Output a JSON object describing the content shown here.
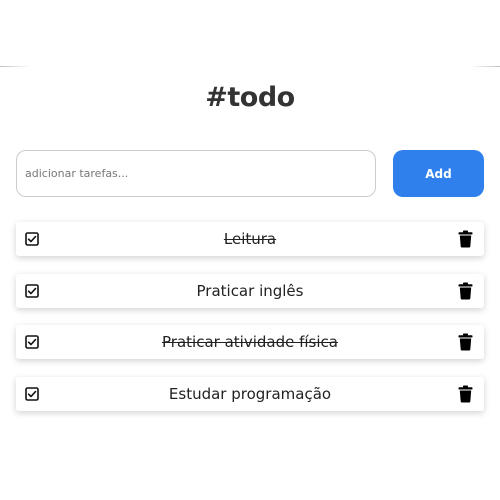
{
  "header": {
    "title": "#todo"
  },
  "form": {
    "input_placeholder": "adicionar tarefas...",
    "input_value": "",
    "add_label": "Add"
  },
  "tasks": [
    {
      "label": "Leitura",
      "done": true
    },
    {
      "label": "Praticar inglês",
      "done": false
    },
    {
      "label": "Praticar atividade física",
      "done": true
    },
    {
      "label": "Estudar programação",
      "done": false
    }
  ],
  "colors": {
    "accent": "#2f80ed",
    "text": "#333333"
  },
  "icons": {
    "checkbox": "checkbox-checked-icon",
    "delete": "trash-icon"
  }
}
